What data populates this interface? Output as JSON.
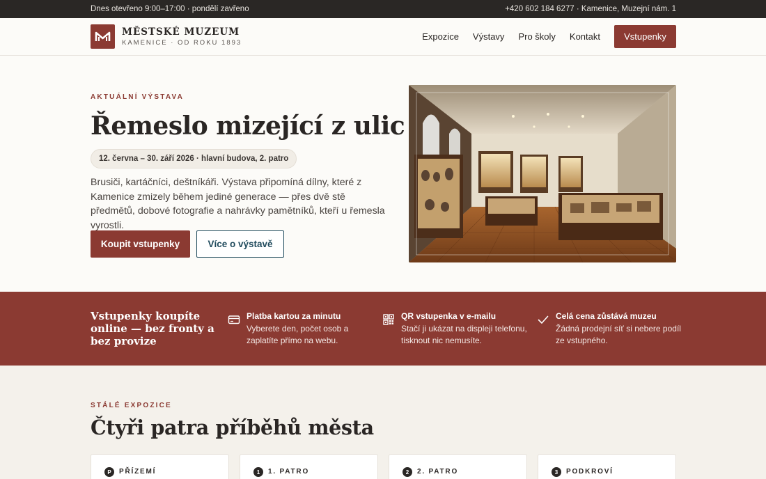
{
  "topbar": {
    "hours": "Dnes otevřeno 9:00–17:00 · pondělí zavřeno",
    "contact": "+420 602 184 6277 · Kamenice, Muzejní nám. 1"
  },
  "brand": {
    "name": "MĚSTSKÉ MUZEUM",
    "sub": "KAMENICE · OD ROKU 1893"
  },
  "nav": {
    "items": [
      "Expozice",
      "Výstavy",
      "Pro školy",
      "Kontakt"
    ],
    "cta": "Vstupenky"
  },
  "hero": {
    "eyebrow": "AKTUÁLNÍ VÝSTAVA",
    "title": "Řemeslo mizející z ulic",
    "meta": "12. června – 30. září 2026 · hlavní budova, 2. patro",
    "description": "Brusiči, kartáčníci, deštníkáři. Výstava připomíná dílny, které z Kamenice zmizely během jediné generace — přes dvě stě předmětů, dobové fotografie a nahrávky pamětníků, kteří u řemesla vyrostli.",
    "primary_button": "Koupit vstupenky",
    "secondary_button": "Více o výstavě"
  },
  "band": {
    "title": "Vstupenky koupíte online — bez fronty a bez provize",
    "features": [
      {
        "icon": "credit-card-icon",
        "title": "Platba kartou za minutu",
        "desc": "Vyberete den, počet osob a zaplatíte přímo na webu."
      },
      {
        "icon": "qr-code-icon",
        "title": "QR vstupenka v e-mailu",
        "desc": "Stačí ji ukázat na displeji telefonu, tisknout nic nemusíte."
      },
      {
        "icon": "check-icon",
        "title": "Celá cena zůstává muzeu",
        "desc": "Žádná prodejní síť si nebere podíl ze vstupného."
      }
    ]
  },
  "collection": {
    "eyebrow": "STÁLÉ EXPOZICE",
    "title": "Čtyři patra příběhů města",
    "floors": [
      {
        "badge": "P",
        "label": "PŘÍZEMÍ"
      },
      {
        "badge": "1",
        "label": "1. PATRO"
      },
      {
        "badge": "2",
        "label": "2. PATRO"
      },
      {
        "badge": "3",
        "label": "PODKROVÍ"
      }
    ]
  },
  "colors": {
    "accent": "#8b3a32",
    "dark": "#2a2725",
    "secondary": "#1f4a5c",
    "background": "#fcfbf8"
  }
}
